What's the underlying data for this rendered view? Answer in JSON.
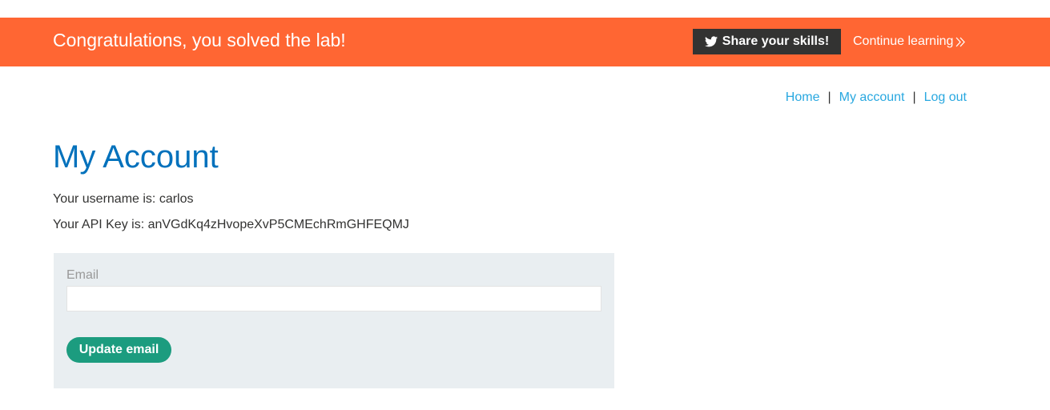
{
  "banner": {
    "title": "Congratulations, you solved the lab!",
    "share_label": "Share your skills!",
    "share_icon": "twitter-icon",
    "continue_label": "Continue learning",
    "continue_icon": "double-chevron-right-icon",
    "background_color": "#ff6633"
  },
  "nav": {
    "items": [
      {
        "label": "Home"
      },
      {
        "label": "My account"
      },
      {
        "label": "Log out"
      }
    ],
    "separator": "|",
    "link_color": "#29a8e0"
  },
  "main": {
    "title": "My Account",
    "username_line": "Your username is: carlos",
    "apikey_line": "Your API Key is: anVGdKq4zHvopeXvP5CMEchRmGHFEQMJ"
  },
  "form": {
    "email_label": "Email",
    "email_value": "",
    "submit_label": "Update email",
    "button_color": "#1c9c7f"
  }
}
